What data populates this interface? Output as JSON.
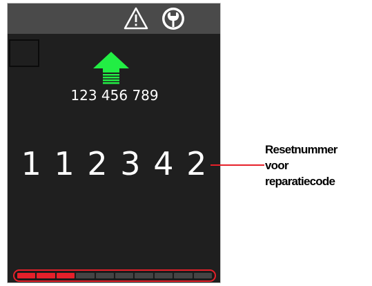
{
  "device": {
    "top_bar": {
      "icons": [
        "warning-triangle-icon",
        "wrench-icon"
      ]
    },
    "lift_arrow": {
      "icon": "up-arrow-icon",
      "color": "#22ee44"
    },
    "serial_number": "123 456 789",
    "reset_code": "1 1 2 3 4 2",
    "progress": {
      "segments_total": 10,
      "segments_on": 3,
      "color_on": "#e6202a",
      "color_off": "#444444"
    }
  },
  "callout": {
    "label": "Resetnummer\nvoor\nreparatiecode",
    "color": "#e6202a"
  }
}
